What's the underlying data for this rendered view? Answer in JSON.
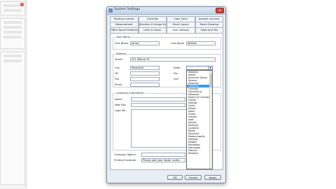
{
  "dialog": {
    "title": "System Settings",
    "close_glyph": "x",
    "tabs_row1": [
      "Routing License",
      "Checklist",
      "Color Form",
      "Analytic Account"
    ],
    "tabs_row2": [
      "Measurement",
      "Direction & Image Setting",
      "Email Layout",
      "Route Drawing"
    ],
    "tabs_row3": [
      "Office Route Preferences",
      "Units & Cases",
      "User Settings",
      "Sales and Tax"
    ],
    "active_tab": "User Settings"
  },
  "form": {
    "user_name_label": "User Name",
    "first_name_label": "First Name",
    "first_name_value": "James",
    "last_name_label": "Last Name",
    "last_name_value": "Weston",
    "address_group_label": "Address",
    "street_label": "Street",
    "street_value": "221 Walnut St",
    "city_label": "City",
    "city_value": "Pasadena",
    "state_label": "State",
    "tel_label": "Tel",
    "zip_label": "Zip",
    "fax_label": "Fax",
    "cell_label": "Cell",
    "email_label": "Email",
    "company_info_label": "Company Information",
    "name_label": "Name",
    "web_site_label": "Web Site",
    "logo_file_label": "Logo file",
    "company_tagline_label": "Company Tagline",
    "printout_footnote_label": "Printout Footnote",
    "printout_footnote_value": "Please add your footer under..."
  },
  "state_dropdown": {
    "items": [
      "Alabama",
      "Alaska",
      "American Samoa",
      "Arizona",
      "Arkansas",
      "California",
      "Colorado",
      "Connecticut",
      "Delaware",
      "District of Columbia",
      "Florida",
      "Georgia",
      "Guam",
      "Hawaii",
      "Idaho",
      "Illinois",
      "Indiana",
      "Iowa",
      "Kansas",
      "Kentucky",
      "Louisiana",
      "Maine",
      "Maryland",
      "Massachusetts",
      "Michigan",
      "Midway",
      "Minnesota",
      "Mississippi",
      "Missouri",
      "Montana"
    ],
    "selected_index": 5,
    "arrow_glyph": "▼"
  },
  "buttons": {
    "ok": "OK",
    "cancel": "Cancel",
    "apply": "Apply"
  },
  "colors": {
    "selection": "#3399ff",
    "close_button": "#c9473d"
  }
}
